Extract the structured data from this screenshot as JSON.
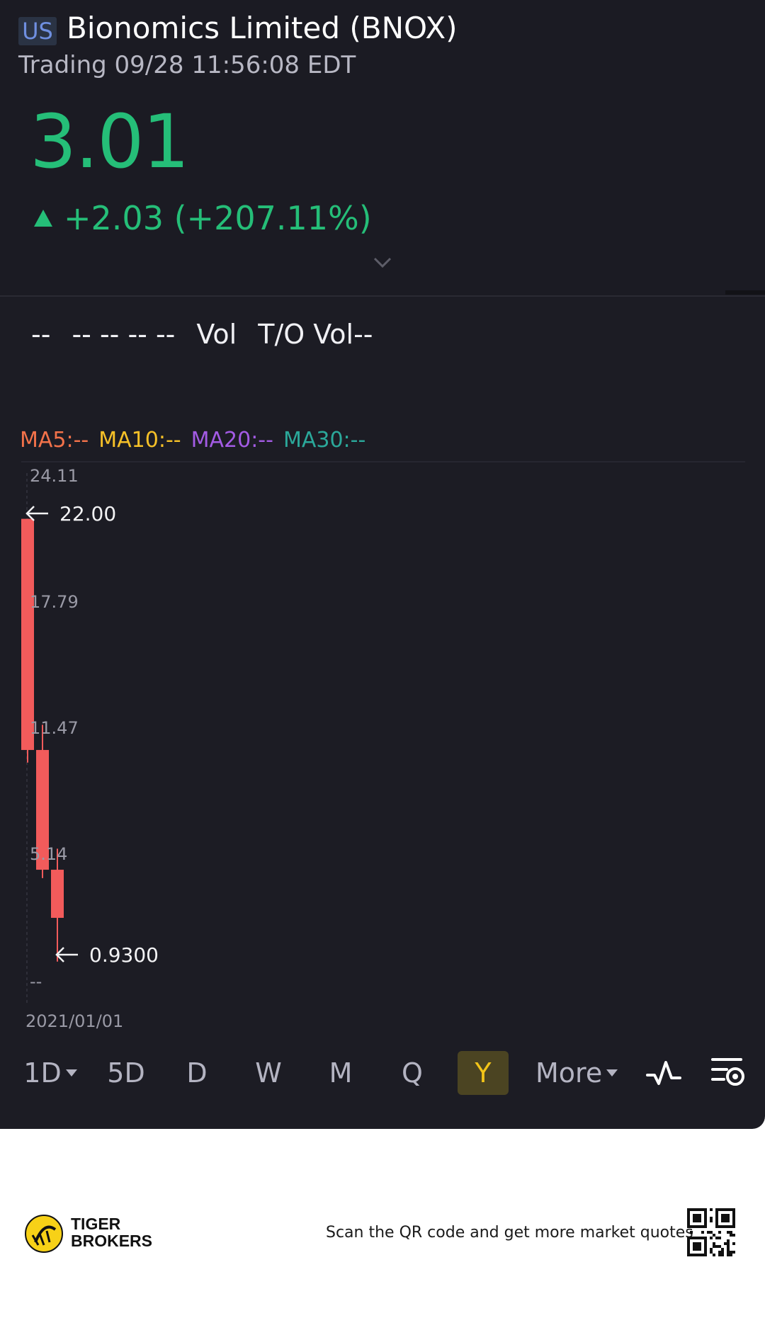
{
  "header": {
    "market": "US",
    "title": "Bionomics Limited (BNOX)",
    "status": "Trading 09/28 11:56:08 EDT",
    "price": "3.01",
    "change": "+2.03 (+207.11%)",
    "colors": {
      "up": "#25be78",
      "down_candle": "#f25b5b"
    }
  },
  "stats": {
    "dashes": [
      "--",
      "-- -- -- --"
    ],
    "vol_label": "Vol",
    "turnover_label": "T/O Vol--"
  },
  "indicators": {
    "ma5": "MA5:--",
    "ma10": "MA10:--",
    "ma20": "MA20:--",
    "ma30": "MA30:--"
  },
  "chart": {
    "y_ticks": [
      "24.11",
      "17.79",
      "11.47",
      "5.14",
      "--"
    ],
    "x_label": "2021/01/01",
    "high_marker": "22.00",
    "low_marker": "0.9300"
  },
  "chart_data": {
    "type": "candlestick",
    "y_ticks": [
      24.11,
      17.79,
      11.47,
      5.14
    ],
    "ylim": [
      -1.17,
      24.11
    ],
    "x_label": "2021/01/01",
    "candles": [
      {
        "open": 22.0,
        "high": 22.0,
        "low": 10.4,
        "close": 11.0
      },
      {
        "open": 11.0,
        "high": 12.2,
        "low": 4.9,
        "close": 5.3
      },
      {
        "open": 5.3,
        "high": 6.3,
        "low": 0.93,
        "close": 3.01
      }
    ],
    "annotations": [
      {
        "label": "22.00",
        "value": 22.0
      },
      {
        "label": "0.9300",
        "value": 0.93
      }
    ]
  },
  "toolbar": {
    "items": [
      {
        "label": "1D",
        "dropdown": true
      },
      {
        "label": "5D"
      },
      {
        "label": "D"
      },
      {
        "label": "W"
      },
      {
        "label": "M"
      },
      {
        "label": "Q"
      },
      {
        "label": "Y",
        "active": true
      },
      {
        "label": "More",
        "dropdown": true
      }
    ],
    "indicator_icon": "line-indicator-icon",
    "settings_icon": "chart-settings-icon"
  },
  "footer": {
    "brand_line1": "TIGER",
    "brand_line2": "BROKERS",
    "text": "Scan the QR code and get more market quotes"
  }
}
